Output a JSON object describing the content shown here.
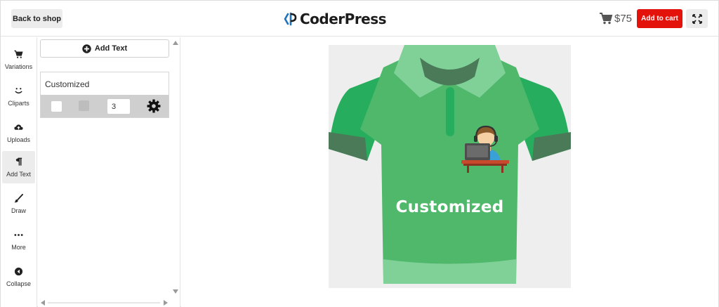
{
  "header": {
    "back_label": "Back to shop",
    "logo_text": "CoderPress",
    "price": "$75",
    "add_to_cart_label": "Add to cart"
  },
  "tools": [
    {
      "label": "Variations",
      "icon": "cart-icon"
    },
    {
      "label": "Cliparts",
      "icon": "smile-icon"
    },
    {
      "label": "Uploads",
      "icon": "cloud-upload-icon"
    },
    {
      "label": "Add Text",
      "icon": "pilcrow-icon",
      "active": true
    },
    {
      "label": "Draw",
      "icon": "brush-icon"
    },
    {
      "label": "More",
      "icon": "more-dots-icon"
    },
    {
      "label": "Collapse",
      "icon": "collapse-left-icon"
    }
  ],
  "panel": {
    "add_text_label": "Add Text",
    "text_item": {
      "value": "Customized",
      "stroke_width": "3",
      "fill_color": "#ffffff",
      "stroke_color": "#bdbdbd"
    }
  },
  "canvas": {
    "custom_text": "Customized",
    "shirt_color": "#4fb86a",
    "clipart": "support-agent-icon"
  },
  "colors": {
    "accent": "#e3120b",
    "brand_blue": "#1e73be"
  }
}
